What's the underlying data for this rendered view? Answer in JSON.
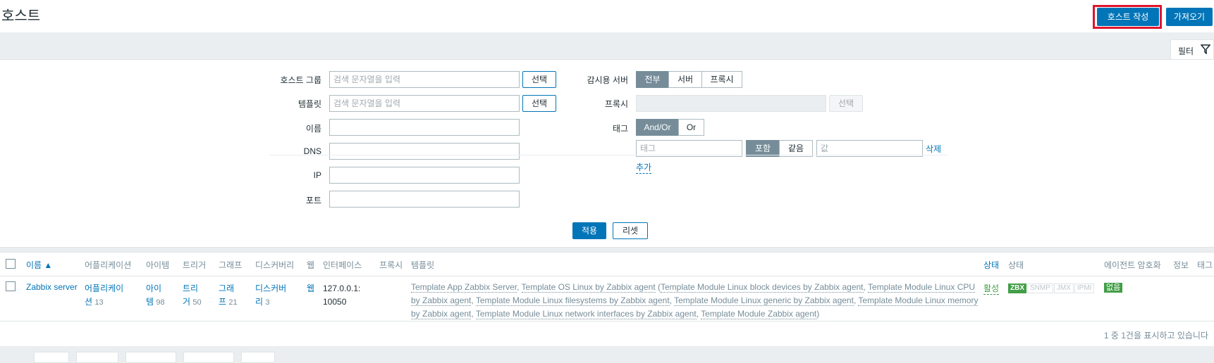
{
  "header": {
    "title": "호스트",
    "create_button": "호스트 작성",
    "import_button": "가져오기"
  },
  "filter_tab": {
    "label": "필터",
    "icon": "funnel-icon"
  },
  "filter": {
    "host_group": {
      "label": "호스트 그룹",
      "placeholder": "검색 문자열을 입력",
      "button": "선택"
    },
    "template": {
      "label": "템플릿",
      "placeholder": "검색 문자열을 입력",
      "button": "선택"
    },
    "name": {
      "label": "이름",
      "value": ""
    },
    "dns": {
      "label": "DNS",
      "value": ""
    },
    "ip": {
      "label": "IP",
      "value": ""
    },
    "port": {
      "label": "포트",
      "value": ""
    },
    "monitored_by": {
      "label": "감시용 서버",
      "options": [
        "전부",
        "서버",
        "프록시"
      ],
      "selected": "전부"
    },
    "proxy": {
      "label": "프록시",
      "button": "선택"
    },
    "tags": {
      "label": "태그",
      "operator_options": [
        "And/Or",
        "Or"
      ],
      "operator_selected": "And/Or",
      "tag_placeholder": "태그",
      "match_options": [
        "포함",
        "같음"
      ],
      "match_selected": "포함",
      "value_placeholder": "값",
      "remove_link": "삭제",
      "add_link": "추가"
    },
    "apply_button": "적용",
    "reset_button": "리셋"
  },
  "table": {
    "columns": {
      "name": "이름 ▲",
      "applications": "어플리케이션",
      "items": "아이템",
      "triggers": "트리거",
      "graphs": "그래프",
      "discovery": "디스커버리",
      "web": "웹",
      "interface": "인터페이스",
      "proxy": "프록시",
      "templates": "템플릿",
      "status": "상태",
      "availability": "상태",
      "agent_encryption": "에이전트 암호화",
      "info": "정보",
      "tags": "태그"
    },
    "rows": [
      {
        "name": "Zabbix server",
        "applications_label_1": "어플리케이",
        "applications_label_2": "션",
        "applications_count": "13",
        "items_label_1": "아이",
        "items_label_2": "템",
        "items_count": "98",
        "triggers_label_1": "트리",
        "triggers_label_2": "거",
        "triggers_count": "50",
        "graphs_label_1": "그래",
        "graphs_label_2": "프",
        "graphs_count": "21",
        "discovery_label_1": "디스커버",
        "discovery_label_2": "리",
        "discovery_count": "3",
        "web": "웹",
        "interface_1": "127.0.0.1:",
        "interface_2": "10050",
        "templates": {
          "t1": "Template App Zabbix Server",
          "sep1": ", ",
          "t2": "Template OS Linux by Zabbix agent",
          "open": " (",
          "t3": "Template Module Linux block devices by Zabbix agent",
          "sep2": ", ",
          "t4": "Template Module Linux CPU by Zabbix agent",
          "sep3": ", ",
          "t5": "Template Module Linux filesystems by Zabbix agent",
          "sep4": ", ",
          "t6": "Template Module Linux generic by Zabbix agent",
          "sep5": ", ",
          "t7": "Template Module Linux memory by Zabbix agent",
          "sep6": ", ",
          "t8": "Template Module Linux network interfaces by Zabbix agent",
          "sep7": ", ",
          "t9": "Template Module Zabbix agent",
          "close": ")"
        },
        "status": "활성",
        "availability": {
          "zbx": "ZBX",
          "snmp": "SNMP",
          "jmx": "JMX",
          "ipmi": "IPMI"
        },
        "encryption": "없음"
      }
    ],
    "footer": "1 중 1건을 표시하고 있습니다"
  },
  "colors": {
    "primary": "#0275b8",
    "highlight": "#e0152c",
    "green": "#429e47",
    "segment_selected": "#768d99"
  }
}
